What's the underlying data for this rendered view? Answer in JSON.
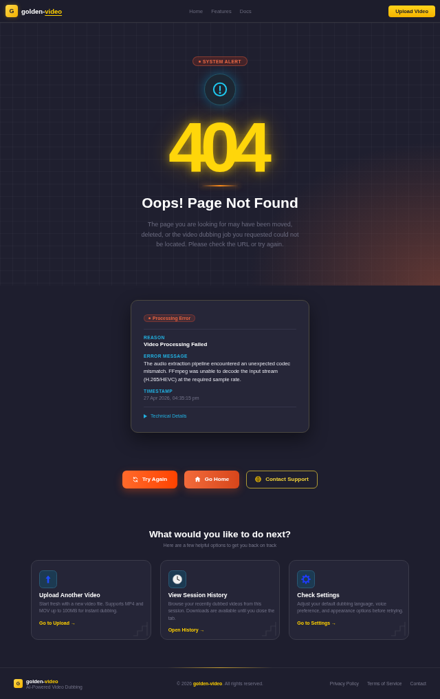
{
  "header": {
    "logo_letter": "G",
    "brand": "golden-",
    "brand_highlight": "video",
    "nav": [
      "Home",
      "Features",
      "Docs"
    ],
    "action": "Upload Video"
  },
  "hero": {
    "badge": "SYSTEM ALERT",
    "code": "404",
    "title": "Oops! Page Not Found",
    "message": "The page you are looking for may have been moved, deleted, or the video dubbing job you requested could not be located. Please check the URL or try again."
  },
  "error_card": {
    "badge": "Processing Error",
    "fields": [
      {
        "kind": "heading",
        "label": "REASON",
        "value": "Video Processing Failed"
      },
      {
        "kind": "text",
        "label": "ERROR MESSAGE",
        "value": "The audio extraction pipeline encountered an unexpected codec mismatch. FFmpeg was unable to decode the input stream (H.265/HEVC) at the required sample rate."
      },
      {
        "kind": "muted",
        "label": "TIMESTAMP",
        "value": "27 Apr 2026, 04:35:15 pm"
      }
    ],
    "details": {
      "label": "Technical Details",
      "expanded": false
    }
  },
  "actions": [
    {
      "kind": "primary",
      "label": "Try Again"
    },
    {
      "kind": "secondary",
      "label": "Go Home"
    },
    {
      "kind": "outline",
      "label": "Contact Support"
    }
  ],
  "next_steps": {
    "title": "What would you like to do next?",
    "subtitle": "Here are a few helpful options to get you back on track",
    "cards": [
      {
        "title": "Upload Another Video",
        "description": "Start fresh with a new video file. Supports MP4 and MOV up to 100MB for instant dubbing.",
        "link": "Go to Upload →"
      },
      {
        "title": "View Session History",
        "description": "Browse your recently dubbed videos from this session. Downloads are available until you close the tab.",
        "link": "Open History →"
      },
      {
        "title": "Check Settings",
        "description": "Adjust your default dubbing language, voice preference, and appearance options before retrying.",
        "link": "Go to Settings →"
      }
    ]
  },
  "footer": {
    "logo_letter": "G",
    "brand": "golden-",
    "brand_highlight": "video",
    "tagline": "AI-Powered Video Dubbing",
    "copyright": "© 2026 **golden-video**. All rights reserved.",
    "links": [
      "Privacy Policy",
      "Terms of Service",
      "Contact"
    ]
  }
}
